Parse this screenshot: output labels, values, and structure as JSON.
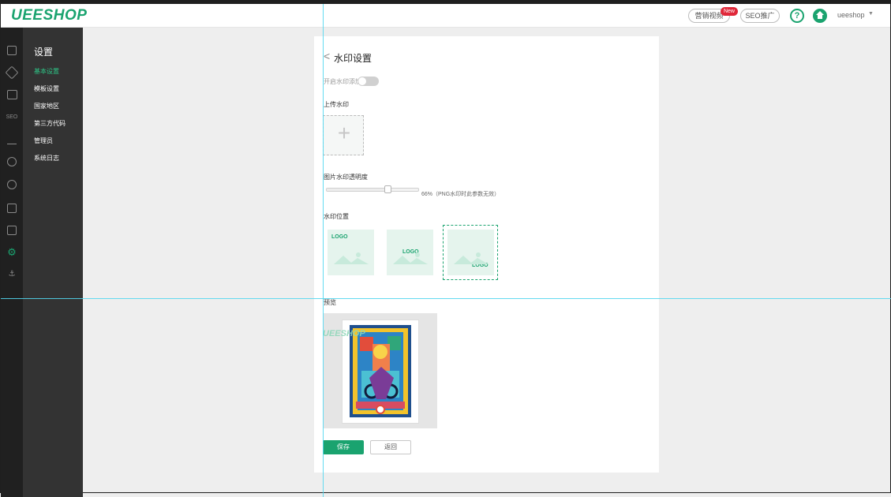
{
  "header": {
    "brand": "UEESHOP",
    "video_button": "营销视频",
    "badge": "New",
    "seo_button": "SEO推广",
    "help_label": "?",
    "user": "ueeshop",
    "caret": "▼"
  },
  "sidebar": {
    "title": "设置",
    "items": [
      {
        "label": "基本设置",
        "active": true
      },
      {
        "label": "模板设置",
        "active": false
      },
      {
        "label": "国家地区",
        "active": false
      },
      {
        "label": "第三方代码",
        "active": false
      },
      {
        "label": "管理员",
        "active": false
      },
      {
        "label": "系统日志",
        "active": false
      }
    ]
  },
  "icons": {
    "clipboard": "clipboard-icon",
    "cube": "cube-icon",
    "book": "book-icon",
    "seo": "SEO",
    "chart": "chart-icon",
    "user": "user-icon",
    "headset": "headset-icon",
    "mail": "mail-icon",
    "apps": "apps-icon",
    "settings": "gear-icon",
    "anchor": "anchor-icon"
  },
  "content": {
    "back": "<",
    "title": "水印设置",
    "enable_label": "开启水印添加",
    "upload_label": "上传水印",
    "plus": "+",
    "opacity_label": "图片水印透明度",
    "opacity_value": 66,
    "opacity_text": "66%（PNG水印时此参数无效）",
    "position_label": "水印位置",
    "positions": [
      {
        "logo": "LOGO",
        "placement": "top-left"
      },
      {
        "logo": "LOGO",
        "placement": "center"
      },
      {
        "logo": "LOGO",
        "placement": "bottom-right",
        "selected": true
      }
    ],
    "preview_label": "预览",
    "preview_watermark": "UEESHOP",
    "save": "保存",
    "return": "返回"
  },
  "colors": {
    "brand": "#1aa36f",
    "sidebar": "#333333",
    "iconbar": "#202020",
    "guide": "#52d7f0"
  }
}
